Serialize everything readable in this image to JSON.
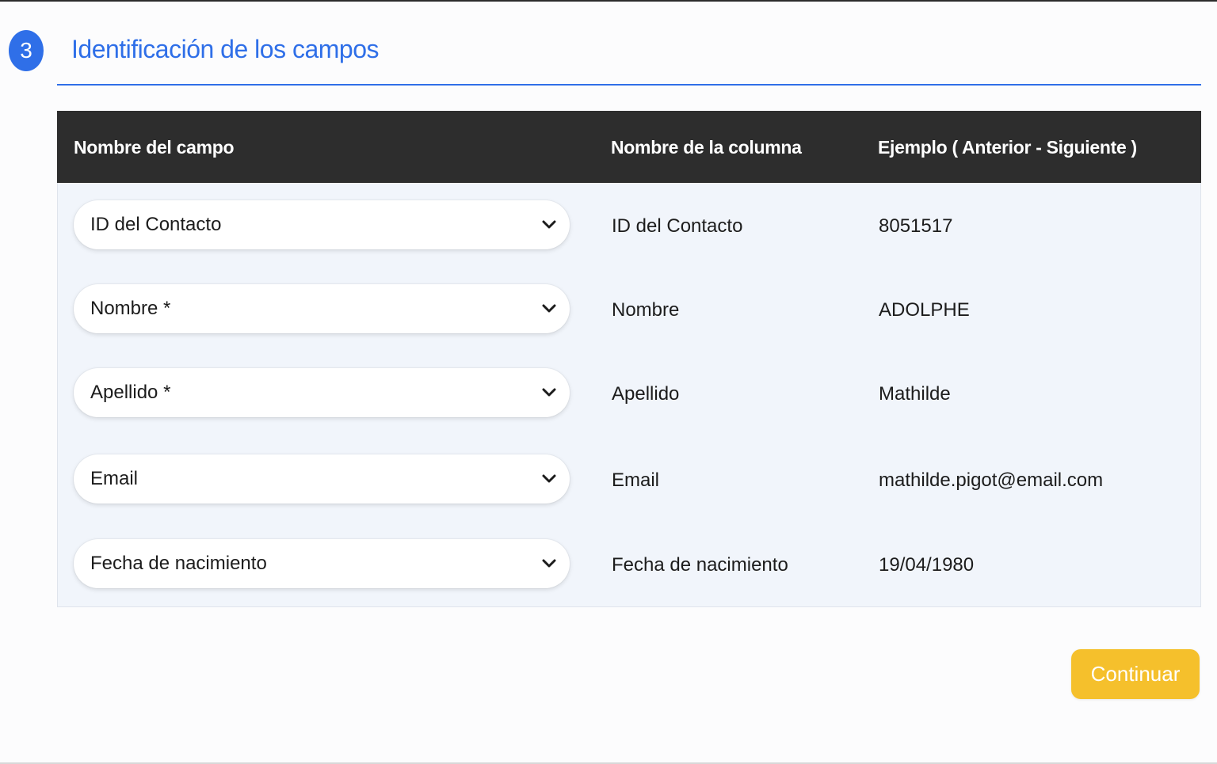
{
  "step": {
    "number": "3",
    "title": "Identificación de los campos"
  },
  "table": {
    "headers": {
      "field": "Nombre del campo",
      "column": "Nombre de la columna",
      "example": "Ejemplo ( Anterior - Siguiente )"
    },
    "rows": [
      {
        "field_selected": "ID del Contacto",
        "column_name": "ID del Contacto",
        "example": "8051517"
      },
      {
        "field_selected": "Nombre *",
        "column_name": "Nombre",
        "example": "ADOLPHE"
      },
      {
        "field_selected": "Apellido *",
        "column_name": "Apellido",
        "example": "Mathilde"
      },
      {
        "field_selected": "Email",
        "column_name": "Email",
        "example": "mathilde.pigot@email.com"
      },
      {
        "field_selected": "Fecha de nacimiento",
        "column_name": "Fecha de nacimiento",
        "example": "19/04/1980"
      }
    ]
  },
  "actions": {
    "continue_label": "Continuar"
  },
  "icons": {
    "dropdown": "chevron-down-icon"
  },
  "colors": {
    "accent": "#2f6fe8",
    "header_bg": "#2d2d2d",
    "table_bg": "#f1f5fb",
    "button": "#f5c02c"
  }
}
